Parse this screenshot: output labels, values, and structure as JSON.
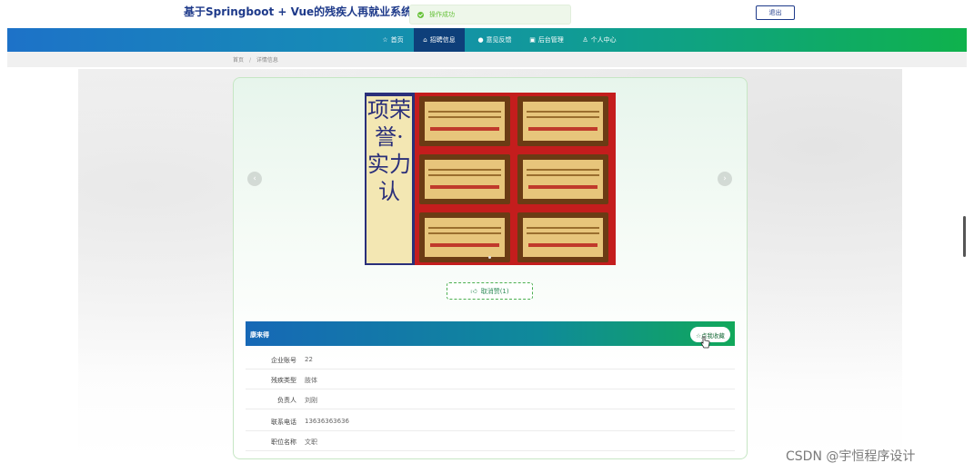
{
  "header": {
    "site_title": "基于Springboot + Vue的残疾人再就业系统",
    "toast": "操作成功",
    "logout_label": "退出"
  },
  "nav": {
    "items": [
      {
        "icon": "home-icon",
        "label": "首页"
      },
      {
        "icon": "house-icon",
        "label": "招聘信息",
        "active": true
      },
      {
        "icon": "feedback-icon",
        "label": "意见反馈"
      },
      {
        "icon": "admin-icon",
        "label": "后台管理"
      },
      {
        "icon": "user-icon",
        "label": "个人中心"
      }
    ]
  },
  "breadcrumb": {
    "home": "首页",
    "current": "详情信息"
  },
  "carousel": {
    "image_alt": "荣誉证书",
    "vertical_text": "项荣誉·实力认",
    "prev_symbol": "‹",
    "next_symbol": "›"
  },
  "like": {
    "label": "取消赞(1)"
  },
  "detail": {
    "company_name": "康来得",
    "favorite_label": "☆点我收藏",
    "rows": [
      {
        "label": "企业账号",
        "value": "22"
      },
      {
        "label": "残疾类型",
        "value": "肢体"
      },
      {
        "label": "负责人",
        "value": "刘刚"
      },
      {
        "label": "联系电话",
        "value": "13636363636"
      },
      {
        "label": "职位名称",
        "value": "文职"
      }
    ]
  },
  "watermark": "CSDN @宇恒程序设计"
}
